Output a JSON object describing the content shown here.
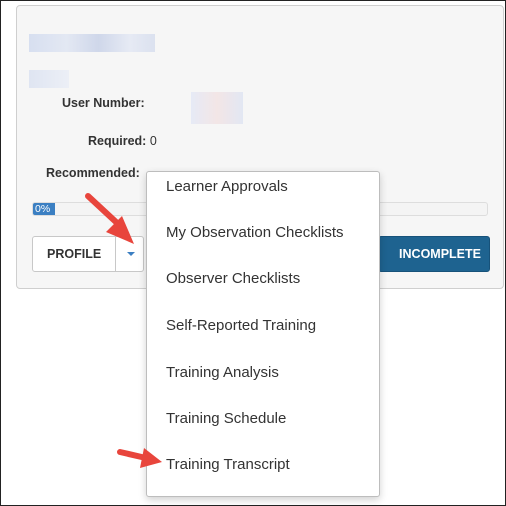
{
  "user_panel": {
    "user_number_label": "User Number:",
    "required_label": "Required:",
    "required_value": "0",
    "recommended_label": "Recommended:",
    "progress": {
      "label": "0%",
      "percent": 0,
      "fill_color": "#3b7fc2"
    },
    "profile_button": "PROFILE",
    "incomplete_button": "INCOMPLETE",
    "incomplete_color": "#1e6390"
  },
  "dropdown_menu": {
    "items": [
      {
        "label": "Learner Approvals"
      },
      {
        "label": "My Observation Checklists"
      },
      {
        "label": "Observer Checklists"
      },
      {
        "label": "Self-Reported Training"
      },
      {
        "label": "Training Analysis"
      },
      {
        "label": "Training Schedule"
      },
      {
        "label": "Training Transcript"
      }
    ]
  },
  "annotation_arrow_color": "#e8453c",
  "icons": {
    "dropdown_caret": "chevron-down-icon",
    "annotation": "red-arrow-icon"
  }
}
